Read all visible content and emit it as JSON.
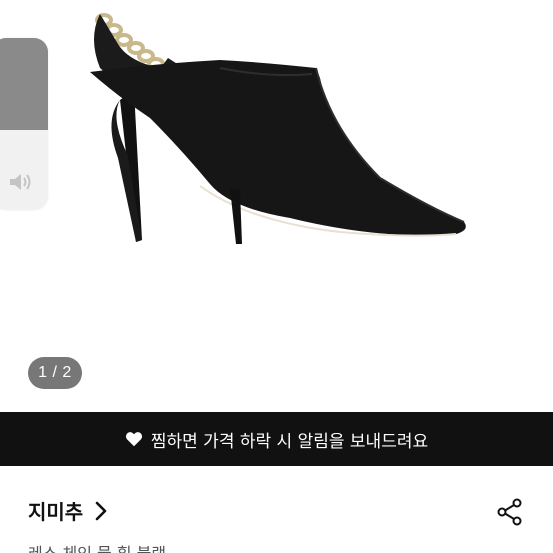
{
  "gallery": {
    "current_page": 1,
    "total_pages": 2,
    "indicator_text": "1 / 2"
  },
  "volume": {
    "level": 0.55,
    "icon": "speaker-icon"
  },
  "wish_banner": {
    "icon": "heart-icon",
    "text": "찜하면 가격 하락 시 알림을 보내드려요"
  },
  "store": {
    "name": "지미추",
    "chevron_icon": "chevron-right-icon",
    "share_icon": "share-icon"
  },
  "product": {
    "title": "레스 체인 뮬 힐 블랙"
  },
  "colors": {
    "banner_bg": "#111111",
    "indicator_bg": "#777777",
    "volume_fill": "#8a8a8a",
    "volume_track": "#f1f1f1"
  }
}
